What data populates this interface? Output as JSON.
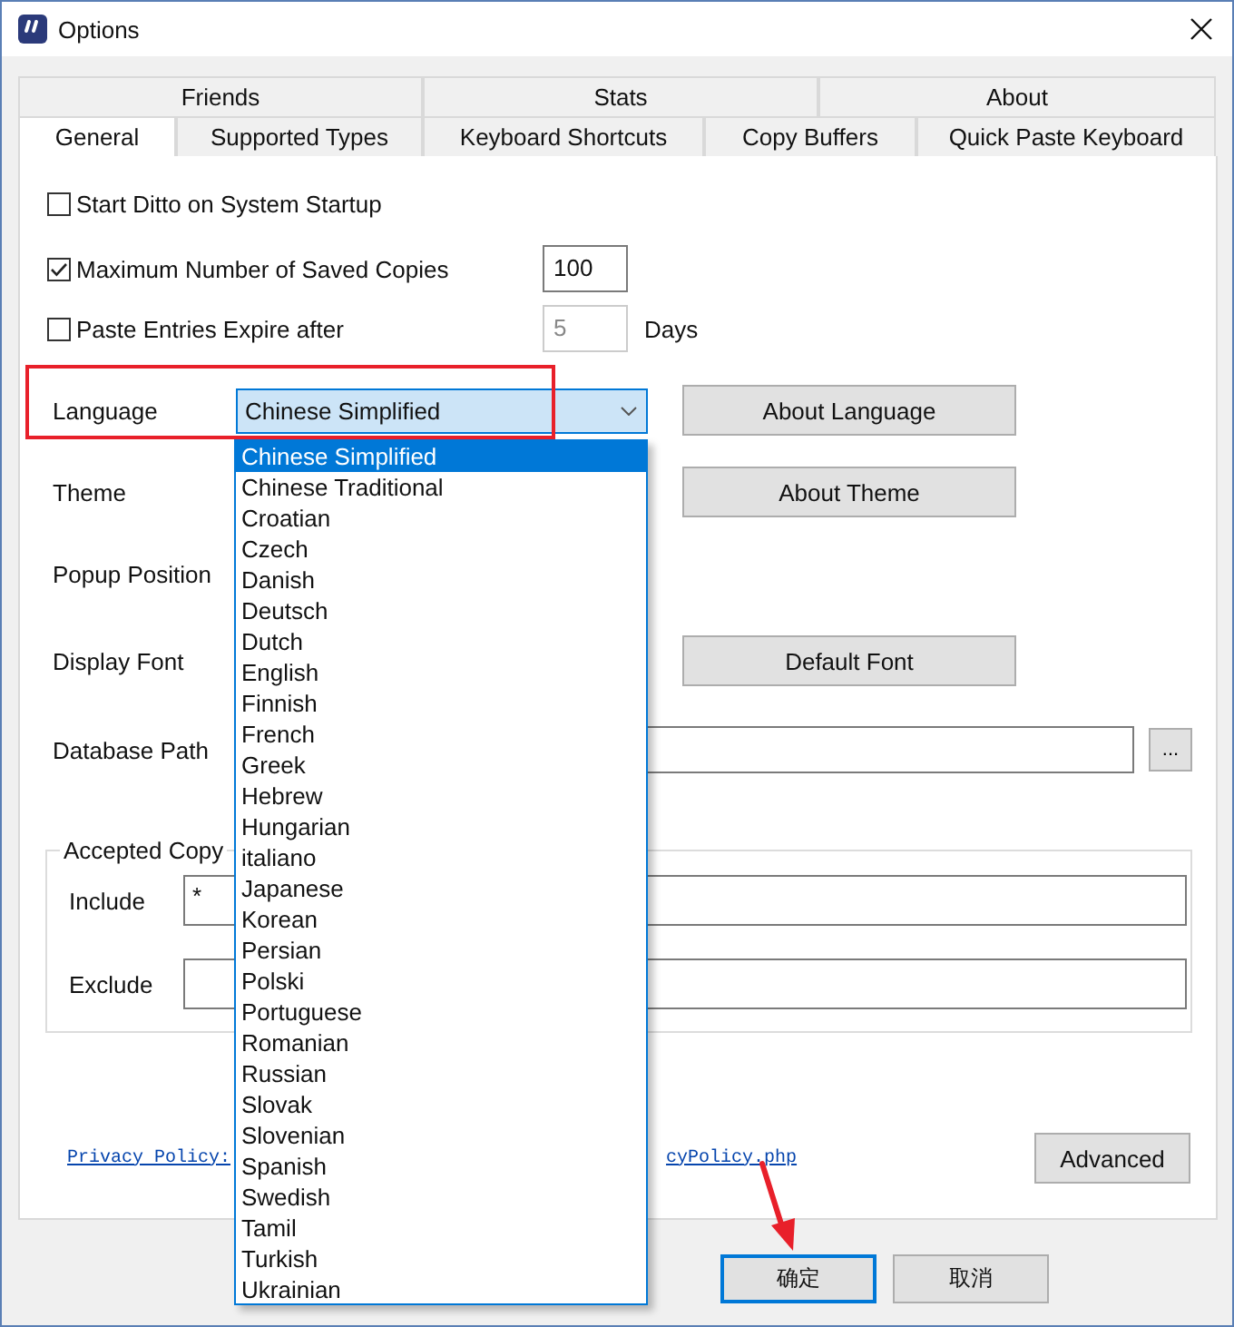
{
  "window": {
    "title": "Options"
  },
  "tabs": [
    [
      {
        "label": "Friends",
        "selected": false
      },
      {
        "label": "Stats",
        "selected": false
      },
      {
        "label": "About",
        "selected": false
      }
    ],
    [
      {
        "label": "General",
        "selected": true
      },
      {
        "label": "Supported Types",
        "selected": false
      },
      {
        "label": "Keyboard Shortcuts",
        "selected": false
      },
      {
        "label": "Copy Buffers",
        "selected": false
      },
      {
        "label": "Quick Paste Keyboard",
        "selected": false
      }
    ]
  ],
  "checkboxes": [
    {
      "label": "Start Ditto on System Startup",
      "checked": false
    },
    {
      "label": "Maximum Number of Saved Copies",
      "checked": true,
      "field": {
        "value": "100",
        "disabled": false
      }
    },
    {
      "label": "Paste Entries Expire after",
      "checked": false,
      "field": {
        "value": "5",
        "disabled": true
      },
      "unit": "Days"
    }
  ],
  "settings": [
    {
      "kind": "combo",
      "label": "Language",
      "value": "Chinese Simplified",
      "button": "About Language"
    },
    {
      "kind": "combo",
      "label": "Theme",
      "button": "About Theme"
    },
    {
      "kind": "combo",
      "label": "Popup Position"
    },
    {
      "kind": "combo",
      "label": "Display Font",
      "button": "Default Font"
    },
    {
      "kind": "path",
      "label": "Database Path",
      "button": "..."
    }
  ],
  "accepted_copy": {
    "legend": "Accepted Copy",
    "include": {
      "label": "Include",
      "value": "*"
    },
    "exclude": {
      "label": "Exclude"
    }
  },
  "privacy_link": [
    "Privacy Policy:",
    "cyPolicy.php"
  ],
  "advanced_button": "Advanced",
  "dialog_buttons": [
    {
      "label": "确定",
      "default": true
    },
    {
      "label": "取消",
      "default": false
    }
  ],
  "dropdown": [
    {
      "label": "Chinese Simplified",
      "selected": true
    },
    {
      "label": "Chinese Traditional",
      "selected": false
    },
    {
      "label": "Croatian",
      "selected": false
    },
    {
      "label": "Czech",
      "selected": false
    },
    {
      "label": "Danish",
      "selected": false
    },
    {
      "label": "Deutsch",
      "selected": false
    },
    {
      "label": "Dutch",
      "selected": false
    },
    {
      "label": "English",
      "selected": false
    },
    {
      "label": "Finnish",
      "selected": false
    },
    {
      "label": "French",
      "selected": false
    },
    {
      "label": "Greek",
      "selected": false
    },
    {
      "label": "Hebrew",
      "selected": false
    },
    {
      "label": "Hungarian",
      "selected": false
    },
    {
      "label": "italiano",
      "selected": false
    },
    {
      "label": "Japanese",
      "selected": false
    },
    {
      "label": "Korean",
      "selected": false
    },
    {
      "label": "Persian",
      "selected": false
    },
    {
      "label": "Polski",
      "selected": false
    },
    {
      "label": "Portuguese",
      "selected": false
    },
    {
      "label": "Romanian",
      "selected": false
    },
    {
      "label": "Russian",
      "selected": false
    },
    {
      "label": "Slovak",
      "selected": false
    },
    {
      "label": "Slovenian",
      "selected": false
    },
    {
      "label": "Spanish",
      "selected": false
    },
    {
      "label": "Swedish",
      "selected": false
    },
    {
      "label": "Tamil",
      "selected": false
    },
    {
      "label": "Turkish",
      "selected": false
    },
    {
      "label": "Ukrainian",
      "selected": false
    }
  ],
  "annotations": {
    "highlight_box": true,
    "arrow": true
  }
}
